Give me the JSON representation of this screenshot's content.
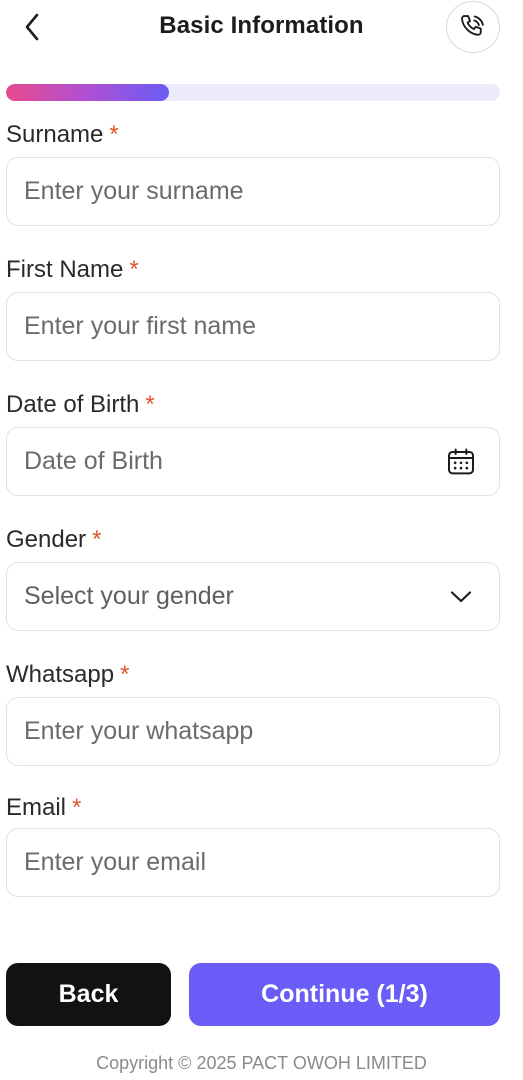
{
  "header": {
    "title": "Basic Information",
    "back_icon": "chevron-left-icon",
    "call_icon": "phone-call-icon"
  },
  "progress": {
    "step": 1,
    "total_steps": 3,
    "fraction": 0.33,
    "fill_colors": [
      "#e84a8a",
      "#6a5cf6"
    ],
    "track_color": "#ecebfb"
  },
  "form": {
    "required_marker": "*",
    "surname": {
      "label": "Surname",
      "placeholder": "Enter your surname"
    },
    "first_name": {
      "label": "First Name",
      "placeholder": "Enter your first name"
    },
    "date_of_birth": {
      "label": "Date of Birth",
      "placeholder": "Date of Birth",
      "icon": "calendar-icon"
    },
    "gender": {
      "label": "Gender",
      "placeholder": "Select your gender",
      "icon": "chevron-down-icon"
    },
    "whatsapp": {
      "label": "Whatsapp",
      "placeholder": "Enter your whatsapp"
    },
    "email": {
      "label": "Email",
      "placeholder": "Enter your email"
    }
  },
  "actions": {
    "back_label": "Back",
    "continue_label": "Continue (1/3)"
  },
  "footer": {
    "copyright": "Copyright © 2025 PACT OWOH LIMITED"
  },
  "colors": {
    "accent": "#6a5cf6",
    "required": "#e0542e",
    "back_button": "#121212"
  }
}
